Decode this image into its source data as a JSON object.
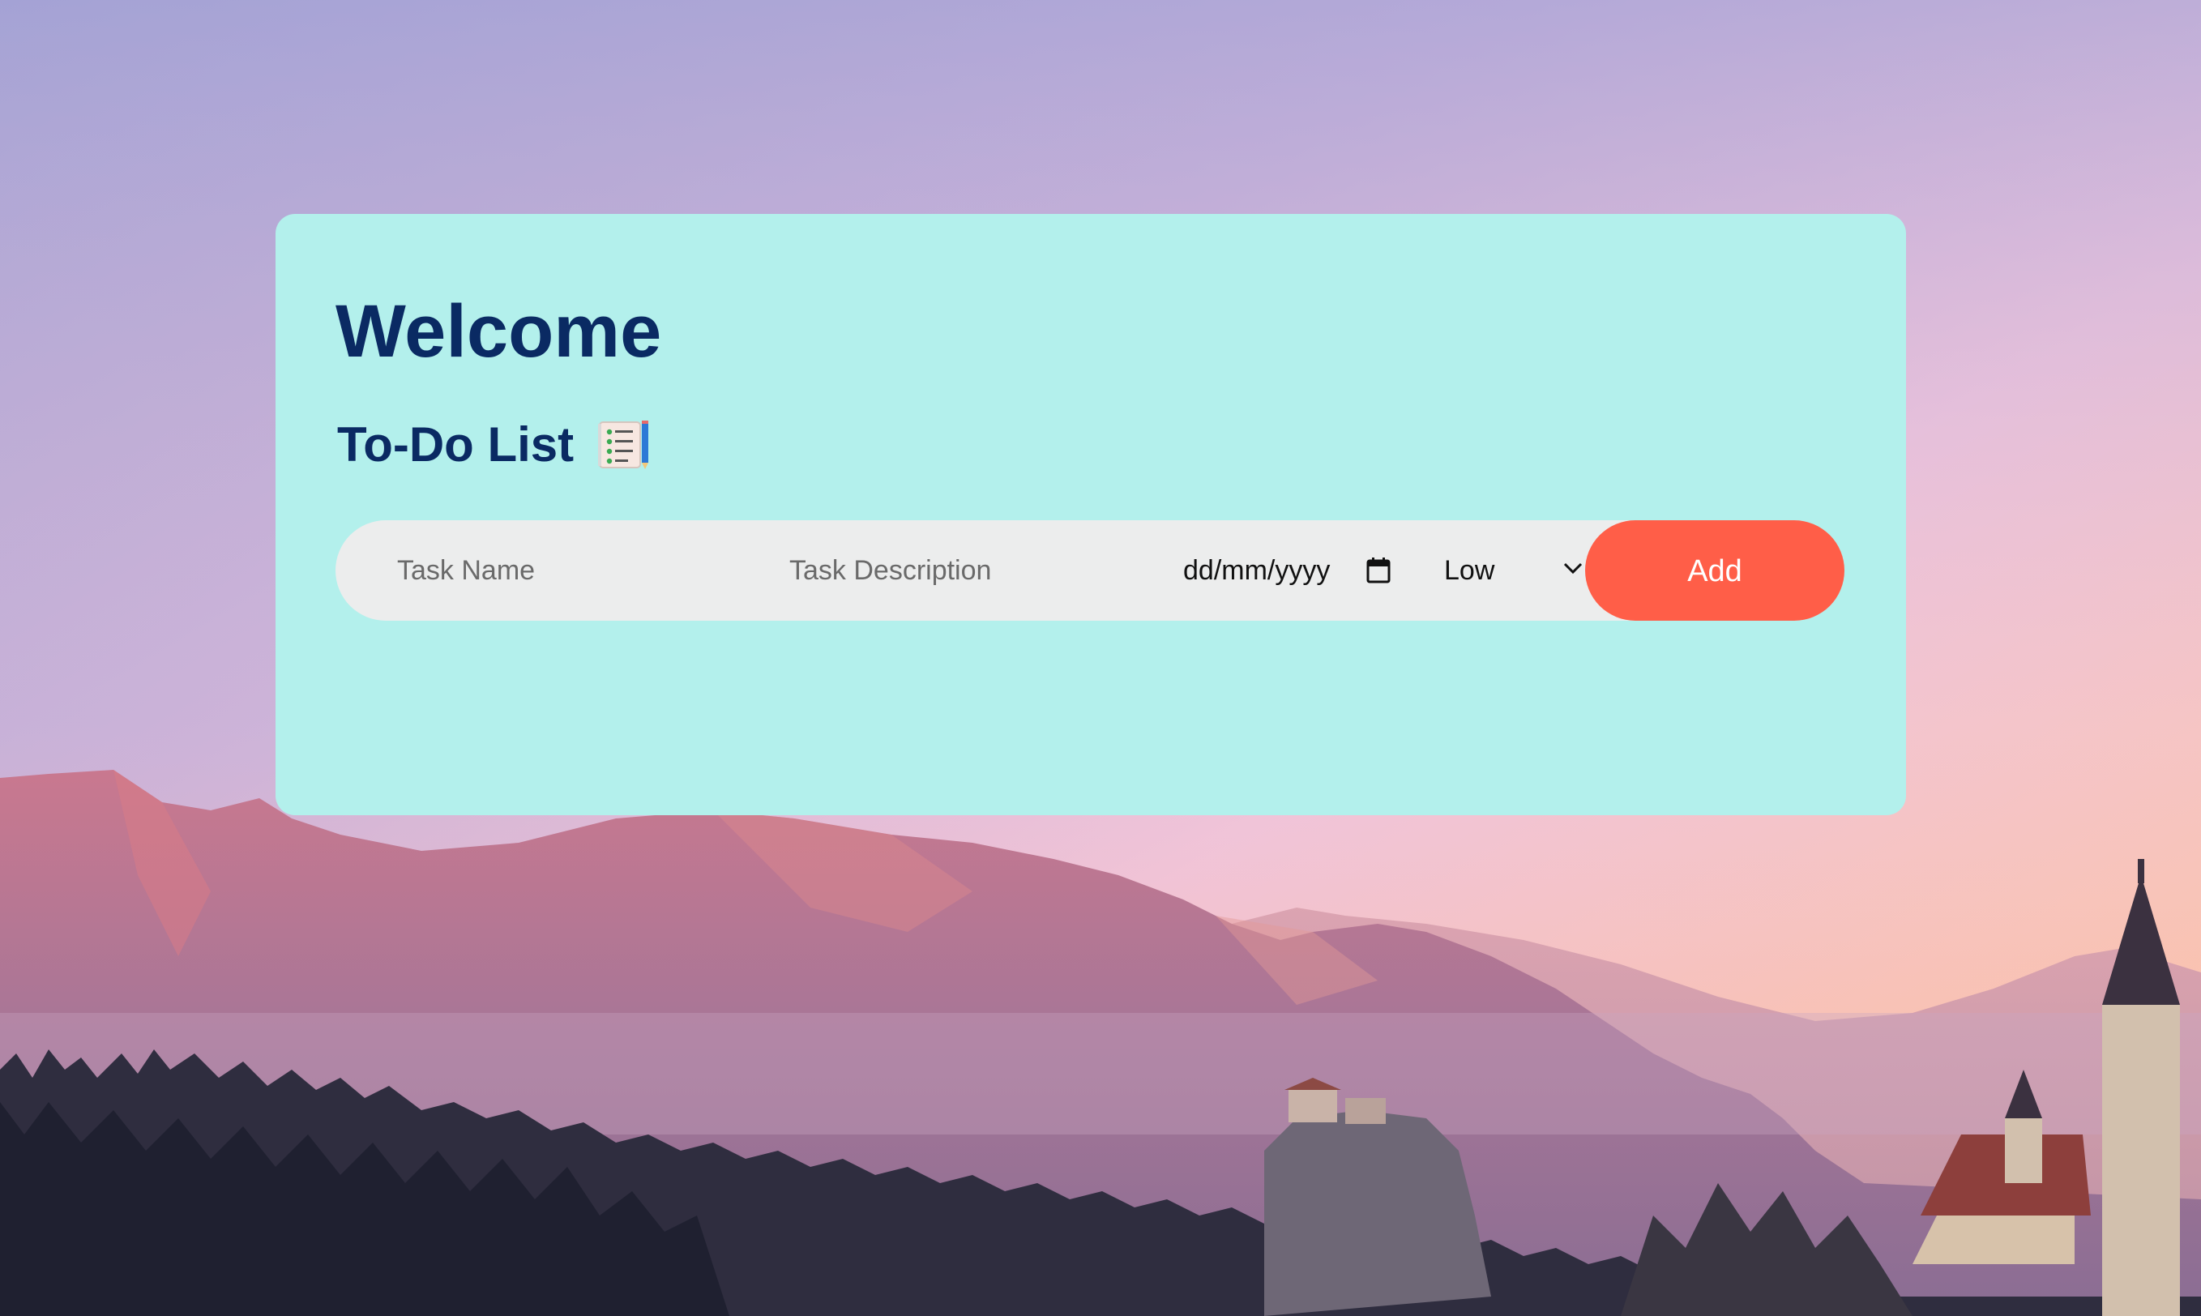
{
  "card": {
    "heading": "Welcome",
    "subtitle": "To-Do List",
    "subtitle_icon": "checklist-notepad-icon"
  },
  "form": {
    "task_name_placeholder": "Task Name",
    "task_name_value": "",
    "task_description_placeholder": "Task Description",
    "task_description_value": "",
    "date_placeholder": "dd/mm/yyyy",
    "date_icon": "calendar-icon",
    "priority_selected": "Low",
    "priority_icon": "chevron-down-icon",
    "add_label": "Add"
  },
  "colors": {
    "card_background": "#b3f0ec",
    "heading_text": "#0a2a63",
    "form_background": "#eceded",
    "add_button": "#ff5e48",
    "add_button_text": "#ffffff"
  },
  "background": {
    "description_icon": "mountain-sunset-background"
  }
}
